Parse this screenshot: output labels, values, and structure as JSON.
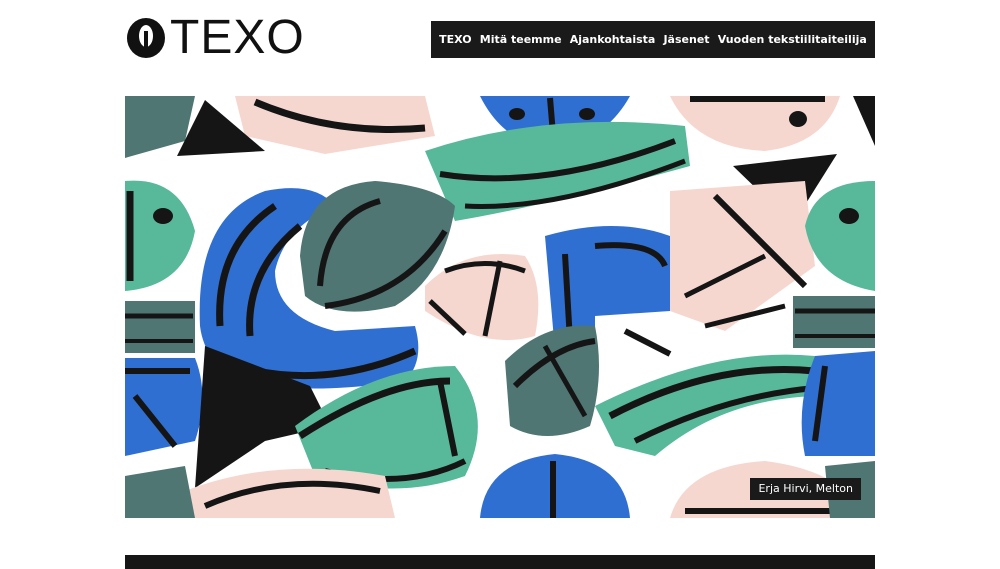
{
  "logo": {
    "text": "TEXO",
    "icon": "texo-logo-mark"
  },
  "nav": {
    "items": [
      {
        "label": "TEXO"
      },
      {
        "label": "Mitä teemme"
      },
      {
        "label": "Ajankohtaista"
      },
      {
        "label": "Jäsenet"
      },
      {
        "label": "Vuoden tekstiilitaiteilija"
      }
    ]
  },
  "hero": {
    "caption": "Erja Hirvi, Melton"
  },
  "colors": {
    "nav_bg": "#1a1a1a",
    "blue": "#2f6fd1",
    "green": "#58b89a",
    "teal_grey": "#4f7673",
    "pink": "#f6d7cf",
    "black": "#151515"
  }
}
